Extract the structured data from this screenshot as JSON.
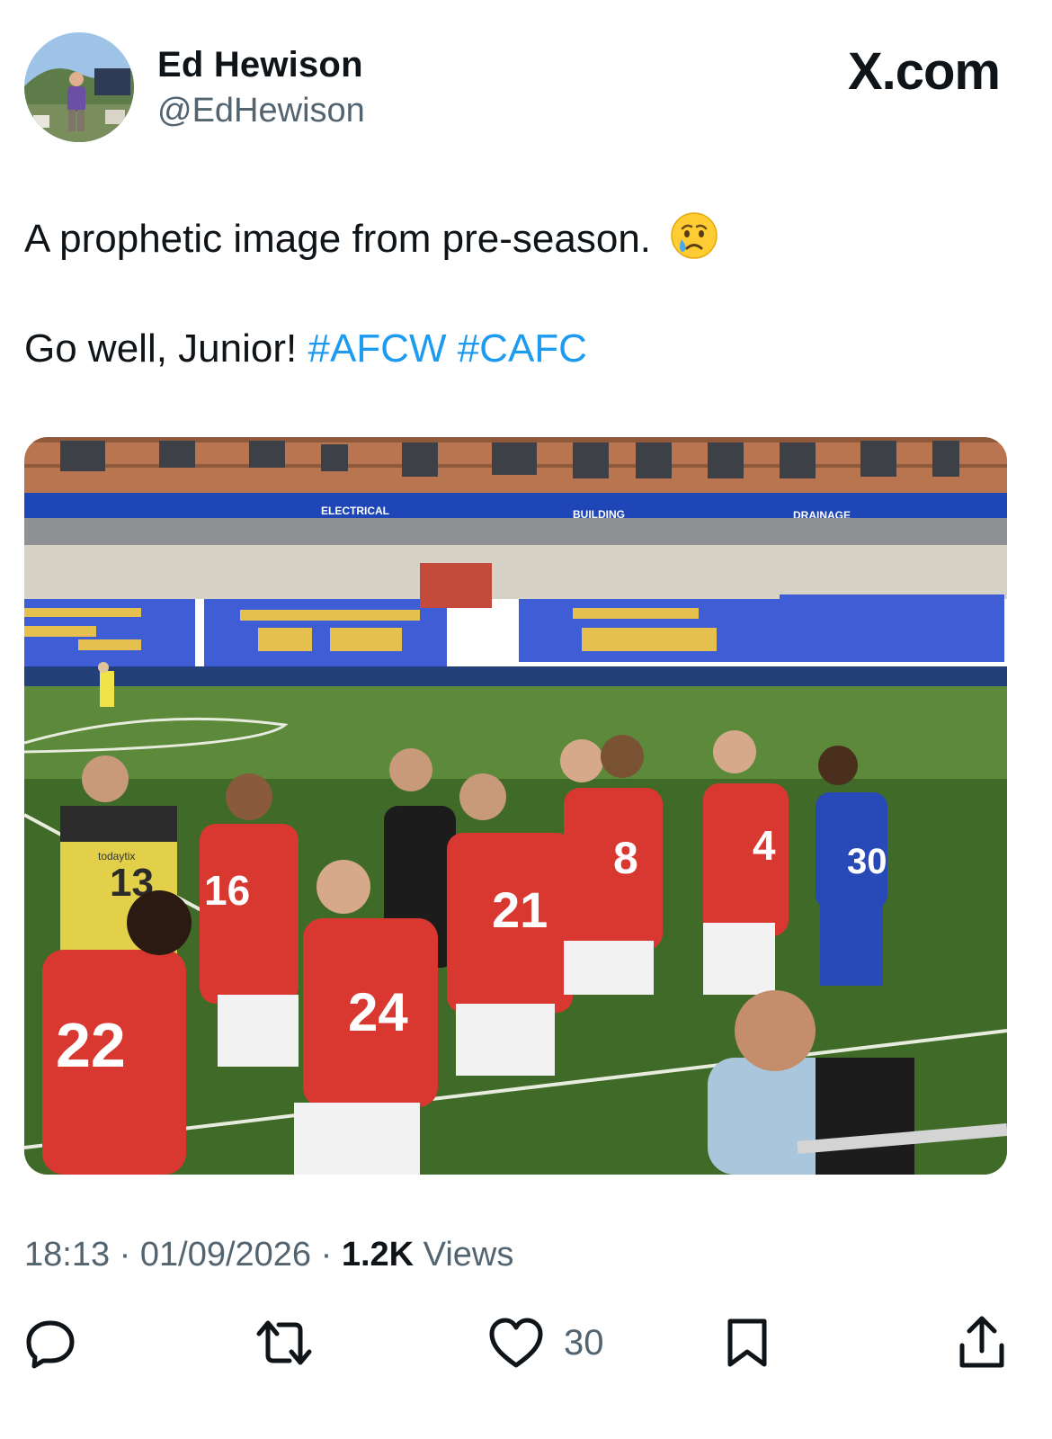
{
  "author": {
    "name": "Ed Hewison",
    "handle": "@EdHewison"
  },
  "brand": "X.com",
  "tweet": {
    "line1": "A prophetic image from pre-season.",
    "line1_emoji": "crying-face-emoji",
    "line2_text": "Go well, Junior!",
    "hashtags": [
      "#AFCW",
      "#CAFC"
    ]
  },
  "photo": {
    "stand_signs": [
      "ELECTRICAL",
      "BUILDING",
      "DRAINAGE"
    ],
    "shirt_sponsor": "todaytix",
    "shirt_numbers": [
      "16",
      "21",
      "8",
      "4",
      "24",
      "22",
      "30",
      "13"
    ]
  },
  "meta": {
    "time": "18:13",
    "separator": " · ",
    "date": "01/09/2026",
    "views_count": "1.2K",
    "views_label": " Views"
  },
  "actions": {
    "reply_icon": "reply-icon",
    "repost_icon": "repost-icon",
    "like_icon": "heart-icon",
    "likes_count": "30",
    "bookmark_icon": "bookmark-icon",
    "share_icon": "share-icon"
  },
  "colors": {
    "link": "#1d9bf0",
    "secondary_text": "#536471",
    "home_kit": "#d8382f",
    "stand_yellow": "#e6c04e",
    "stand_blue": "#3f5ed6"
  }
}
